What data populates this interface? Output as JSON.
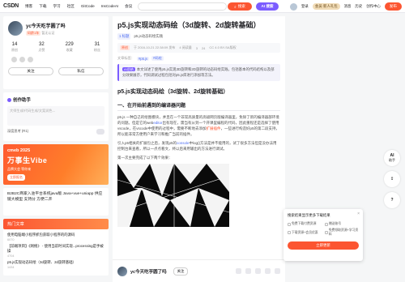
{
  "nav": {
    "logo_brand": "C",
    "logo_text": "SDN",
    "links": [
      "博客",
      "下载",
      "学习",
      "社区",
      "GitCode",
      "InsCodeAI",
      "会议"
    ],
    "search_placeholder": "",
    "search_button": "搜索",
    "ai_button": "AI 搜索",
    "login_text": "登录",
    "vip_text": "会员·新人礼包",
    "right_links": [
      "消息",
      "历史",
      "创作中心"
    ],
    "publish_button": "发布"
  },
  "profile": {
    "name": "yc今天吃芋圆了吗",
    "level_badge": "码龄1年",
    "level_text": "暂无认证",
    "stats": [
      {
        "value": "14",
        "label": "原创"
      },
      {
        "value": "32",
        "label": "点赞"
      },
      {
        "value": "229",
        "label": "收藏"
      },
      {
        "value": "31",
        "label": "粉丝"
      }
    ],
    "follow_button": "关注",
    "message_button": "私信"
  },
  "assistant": {
    "title": "创作助手",
    "placeholder": "大师生成/代码生成/文案润色...",
    "foot_left": "深度思考 (R1)"
  },
  "banner": {
    "line1": "cmeb 2025",
    "line2": "万事生Vibe",
    "line3": "品牌大会 等你来",
    "cta": "立即报名"
  },
  "news": {
    "text": "B2B2C商家入驻平台系统java版 Java+vue+uniapp 供应链大模型 支持分 方便二开"
  },
  "hot": {
    "title": "热门文章",
    "items": [
      {
        "title": "使用电脑端小程序抓包获取小程序的的源码",
        "meta": "6070"
      },
      {
        "title": "【前端项目】《网络》 - 使用当前时间实现...processing是手被操",
        "meta": "4704"
      },
      {
        "title": "p5.js实现动态码绘（3d旋转、2d旋转基础）",
        "meta": "1434"
      }
    ]
  },
  "article": {
    "title": "p5.js实现动态码绘（3d旋转、2d旋转基础）",
    "tag_label": "1 标题",
    "tag_value": "p5.js动态码绘实践",
    "meta_orig": "原创",
    "meta_date": "于 2016-10-21 22:38:09 发布",
    "meta_views": "4 阅读量",
    "meta_likes": "3",
    "meta_fav": "24",
    "meta_license": "CC 4.0 BY-SA版权",
    "cats_label": "文章标签：",
    "cats": [
      "#p5.js",
      "#码绘"
    ],
    "summary_label": "AI总结",
    "summary": "本文详述了使用p5.js实现3D旋转和2D旋转的动态码绘实践，包括基本的代码结构以及部分效果展示，代码调试过程包括对p5.js库进行添加等方法。",
    "h2": "p5.js实现动态码绘（3d旋转、2d旋转基础）",
    "h3": "一、在开始前遇到的编译器问题",
    "para1_a": "p5.js 一种自己的绘图模块，并且在一个非常高质量的高级网页版编译器里，免除了新的编译器部环境的问题。但是它的web",
    "para1_link": "editor",
    "para1_b": "出有现在，需当有从到一个开课里编程的代码，因此重程还是选择了使用vscode，在vscode中使用的过程中，需要不断地去添加",
    "para1_hl": "扩展插件",
    "para1_c": "，一些进行构造好p5的第二段支持，所以能非常方便用户来学习和推广当前的插件。",
    "para2_a": "引入p5相关的扩展包之后，发现p5的",
    "para2_link": "console",
    "para2_b": "中log()方法是并不能用的，试了很多方法但是没办法用控制台来查看，所以一点点看文，终以后来用输出的方法进行调试。",
    "para3": "第一次主要完成了以下两个效果："
  },
  "bottom": {
    "author": "yc今天吃芋圆了吗",
    "follow": "关注"
  },
  "rail": [
    {
      "glyph": "AI",
      "label": "助手"
    },
    {
      "glyph": "⇪",
      "label": ""
    },
    {
      "glyph": "?",
      "label": ""
    }
  ],
  "popup": {
    "title": "搜索结果显示更多下载结果",
    "options": [
      "免费下载付费资源",
      "赠送账号",
      "下载资源+会员优惠",
      "免费领取资源+学习资料"
    ],
    "submit": "立即更新"
  }
}
